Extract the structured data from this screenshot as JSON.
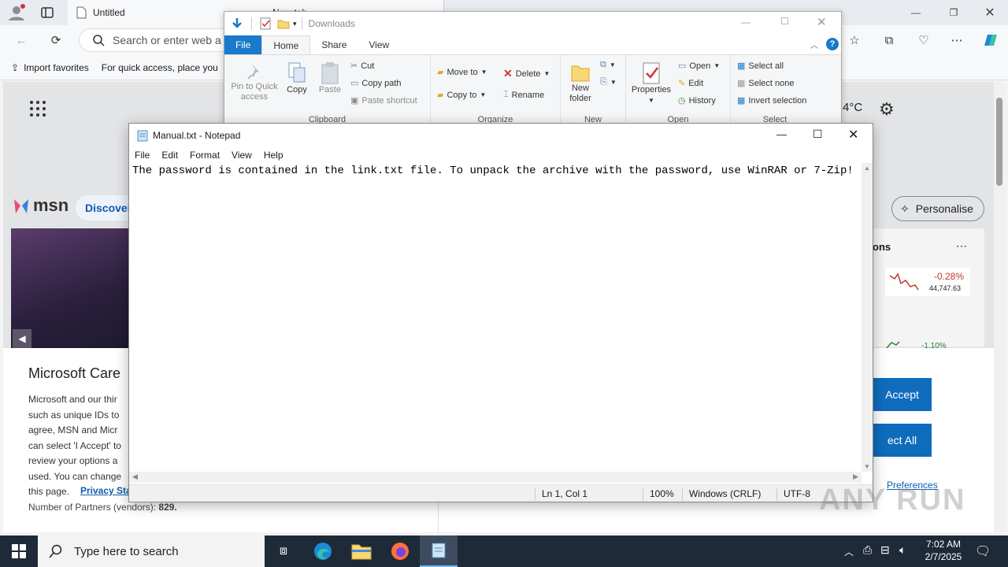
{
  "edge": {
    "tab_active": "Untitled",
    "tab_second": "New tab",
    "address_placeholder": "Search or enter web a",
    "favorites": [
      {
        "label": "Import favorites"
      },
      {
        "label": "For quick access, place you"
      }
    ]
  },
  "msn": {
    "logo": "msn",
    "discover": "Discover",
    "temp": "4°C",
    "personalise": "Personalise",
    "stock_change": "-0.28%",
    "stock_value": "44,747.63",
    "stock_change2": "-1.10%",
    "sidebar_label": "ons",
    "t_partial": "t"
  },
  "consent": {
    "title": "Microsoft Care",
    "body": "Microsoft and our thir such as unique IDs to agree, MSN and Micr can select 'I Accept' to review your options a used.  You can change this page.",
    "privacy_link": "Privacy Sta",
    "partners_label": "Number of Partners (vendors):",
    "partners_count": "829.",
    "accept": "Accept",
    "reject": "ect All",
    "preferences": "Preferences"
  },
  "explorer": {
    "title": "Downloads",
    "tabs": [
      {
        "label": "File"
      },
      {
        "label": "Home"
      },
      {
        "label": "Share"
      },
      {
        "label": "View"
      }
    ],
    "clipboard": {
      "label": "Clipboard",
      "pin": "Pin to Quick access",
      "copy": "Copy",
      "paste": "Paste",
      "cut": "Cut",
      "copy_path": "Copy path",
      "paste_shortcut": "Paste shortcut"
    },
    "organize": {
      "label": "Organize",
      "move_to": "Move to",
      "copy_to": "Copy to",
      "delete": "Delete",
      "rename": "Rename"
    },
    "new": {
      "label": "New",
      "new_folder": "New folder"
    },
    "open": {
      "label": "Open",
      "properties": "Properties",
      "open": "Open",
      "edit": "Edit",
      "history": "History"
    },
    "select": {
      "label": "Select",
      "select_all": "Select all",
      "select_none": "Select none",
      "invert": "Invert selection"
    }
  },
  "notepad": {
    "title": "Manual.txt - Notepad",
    "menu": [
      {
        "label": "File"
      },
      {
        "label": "Edit"
      },
      {
        "label": "Format"
      },
      {
        "label": "View"
      },
      {
        "label": "Help"
      }
    ],
    "content": "The password is contained in the link.txt file. To unpack the archive with the password, use WinRAR or 7-Zip!",
    "status": {
      "position": "Ln 1, Col 1",
      "zoom": "100%",
      "eol": "Windows (CRLF)",
      "encoding": "UTF-8"
    }
  },
  "taskbar": {
    "search_placeholder": "Type here to search",
    "time": "7:02 AM",
    "date": "2/7/2025"
  },
  "watermark": "ANY RUN"
}
